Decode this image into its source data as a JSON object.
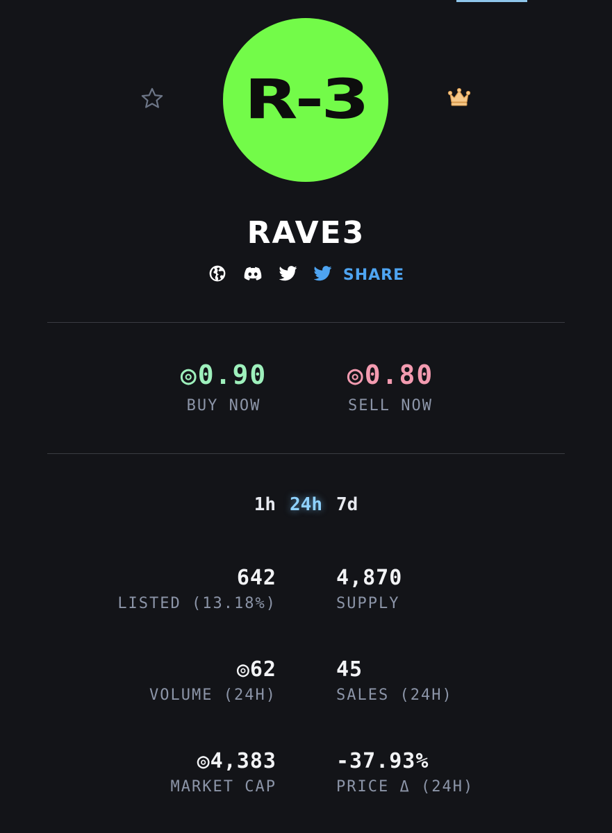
{
  "collection": {
    "name": "RAVE3",
    "logo_text": "R-3"
  },
  "icons": {
    "star": "star-outline-icon",
    "crown": "crown-icon",
    "website": "globe-icon",
    "discord": "discord-icon",
    "twitter": "twitter-icon",
    "share": "twitter-share-icon"
  },
  "social": {
    "share_label": "SHARE"
  },
  "prices": {
    "currency_symbol": "◎",
    "buy": {
      "value": "0.90",
      "label": "BUY NOW"
    },
    "sell": {
      "value": "0.80",
      "label": "SELL NOW"
    }
  },
  "range_tabs": [
    {
      "label": "1h",
      "active": false
    },
    {
      "label": "24h",
      "active": true
    },
    {
      "label": "7d",
      "active": false
    }
  ],
  "stats": {
    "listed": {
      "value": "642",
      "label": "LISTED (13.18%)"
    },
    "supply": {
      "value": "4,870",
      "label": "SUPPLY"
    },
    "volume": {
      "value": "◎62",
      "label": "VOLUME (24H)"
    },
    "sales": {
      "value": "45",
      "label": "SALES (24H)"
    },
    "market_cap": {
      "value": "◎4,383",
      "label": "MARKET CAP"
    },
    "price_change": {
      "value": "-37.93%",
      "label": "PRICE Δ (24H)"
    }
  },
  "colors": {
    "background": "#131418",
    "logo_bg": "#73fb49",
    "buy": "#9ef0bc",
    "sell": "#f39bb0",
    "share": "#4ea4f1",
    "crown": "#f7c98a",
    "active_tab": "#8fd2ff",
    "muted_label": "#8c95a8"
  }
}
